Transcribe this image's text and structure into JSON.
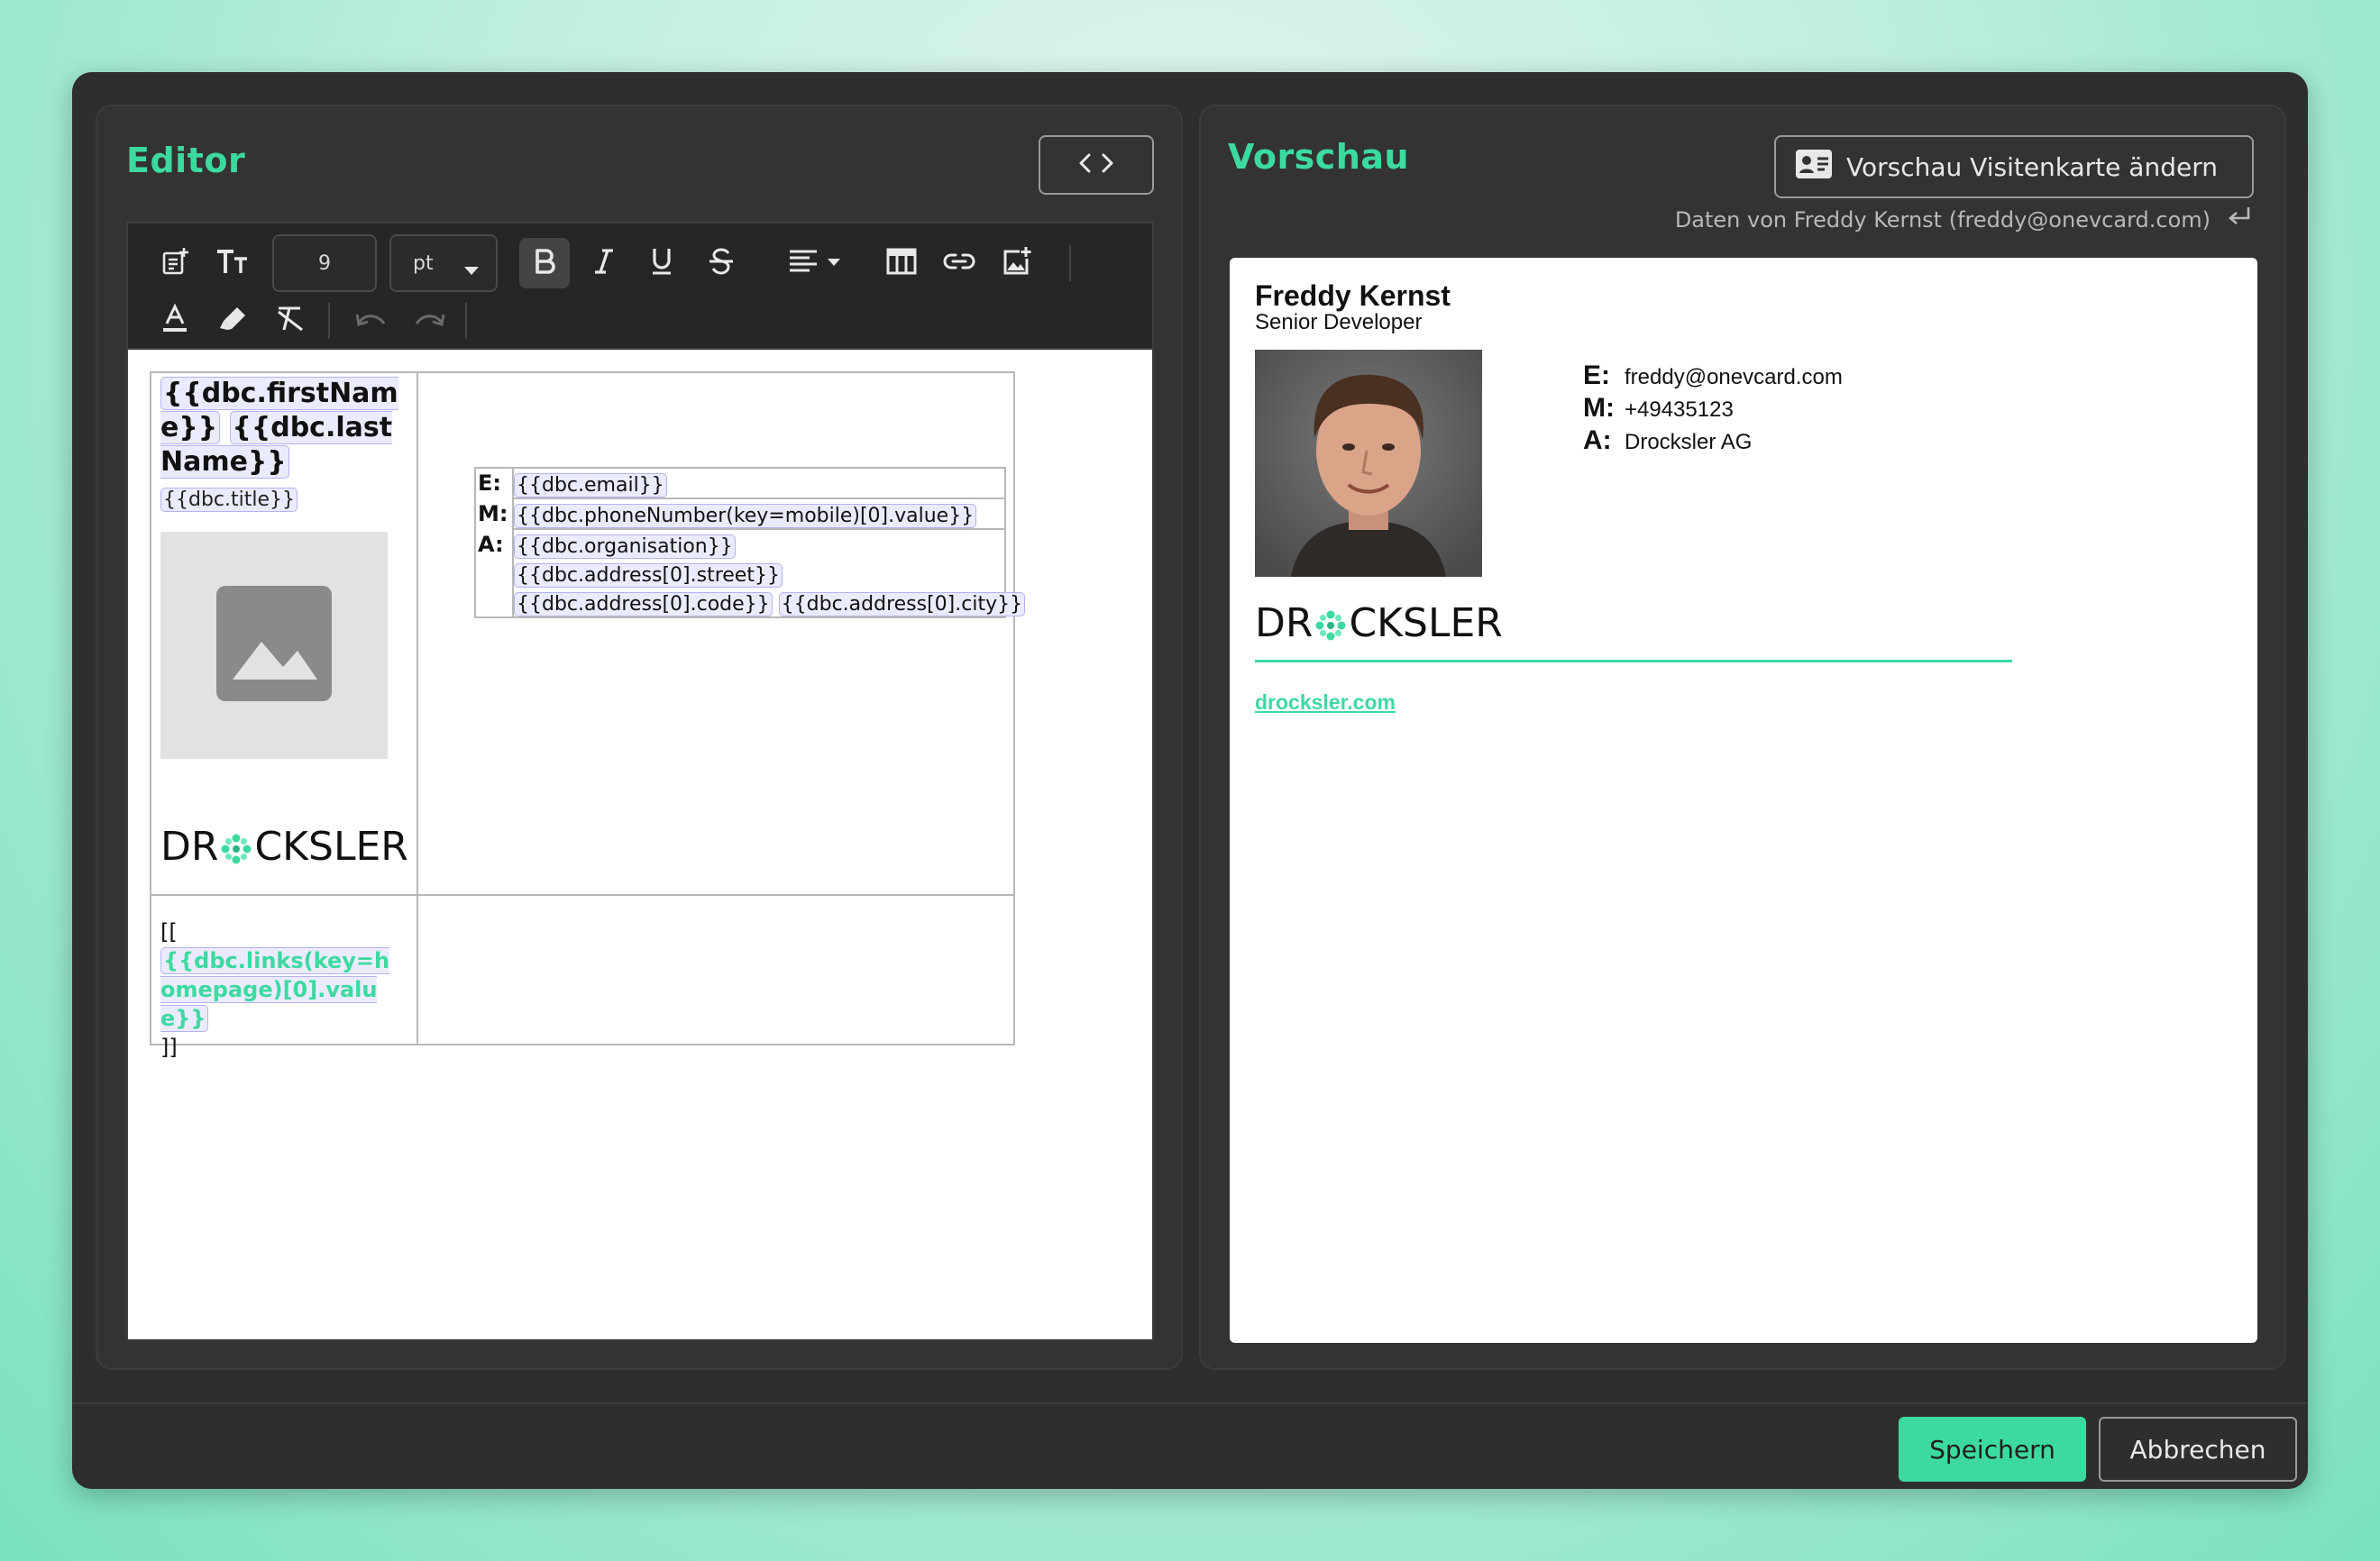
{
  "editor": {
    "title": "Editor",
    "code_toggle_icon": "code-icon",
    "toolbar": {
      "font_size": "9",
      "unit": "pt",
      "icons": [
        "insert-template-icon",
        "font-size-icon",
        "bold-icon",
        "italic-icon",
        "underline-icon",
        "strikethrough-icon",
        "align-icon",
        "table-icon",
        "link-icon",
        "insert-image-icon",
        "font-color-icon",
        "highlight-icon",
        "clear-format-icon",
        "undo-icon",
        "redo-icon"
      ]
    },
    "template": {
      "first_name": "{{dbc.firstName}}",
      "last_name": "{{dbc.lastName}}",
      "title": "{{dbc.title}}",
      "image_icon": "image-placeholder-icon",
      "logo": {
        "left": "DR",
        "right": "CKSLER"
      },
      "links_open": "[[",
      "links": "{{dbc.links(key=homepage)[0].value}}",
      "links_close": "]]",
      "contact": {
        "email_label": "E:",
        "email": "{{dbc.email}}",
        "mobile_label": "M:",
        "mobile": "{{dbc.phoneNumber(key=mobile)[0].value}}",
        "address_label": "A:",
        "organisation": "{{dbc.organisation}}",
        "street": "{{dbc.address[0].street}}",
        "code": "{{dbc.address[0].code}}",
        "city": "{{dbc.address[0].city}}"
      }
    }
  },
  "preview": {
    "title": "Vorschau",
    "change_button": "Vorschau Visitenkarte ändern",
    "data_source": "Daten von Freddy Kernst (freddy@onevcard.com)",
    "name": "Freddy Kernst",
    "job_title": "Senior Developer",
    "email_label": "E:",
    "email": "freddy@onevcard.com",
    "mobile_label": "M:",
    "mobile": "+49435123",
    "address_label": "A:",
    "organisation": "Drocksler AG",
    "logo": {
      "left": "DR",
      "right": "CKSLER"
    },
    "link": "drocksler.com"
  },
  "footer": {
    "save": "Speichern",
    "cancel": "Abbrechen"
  },
  "colors": {
    "accent": "#3ddaa0",
    "panel": "#333333",
    "modal": "#2e2e2e"
  }
}
